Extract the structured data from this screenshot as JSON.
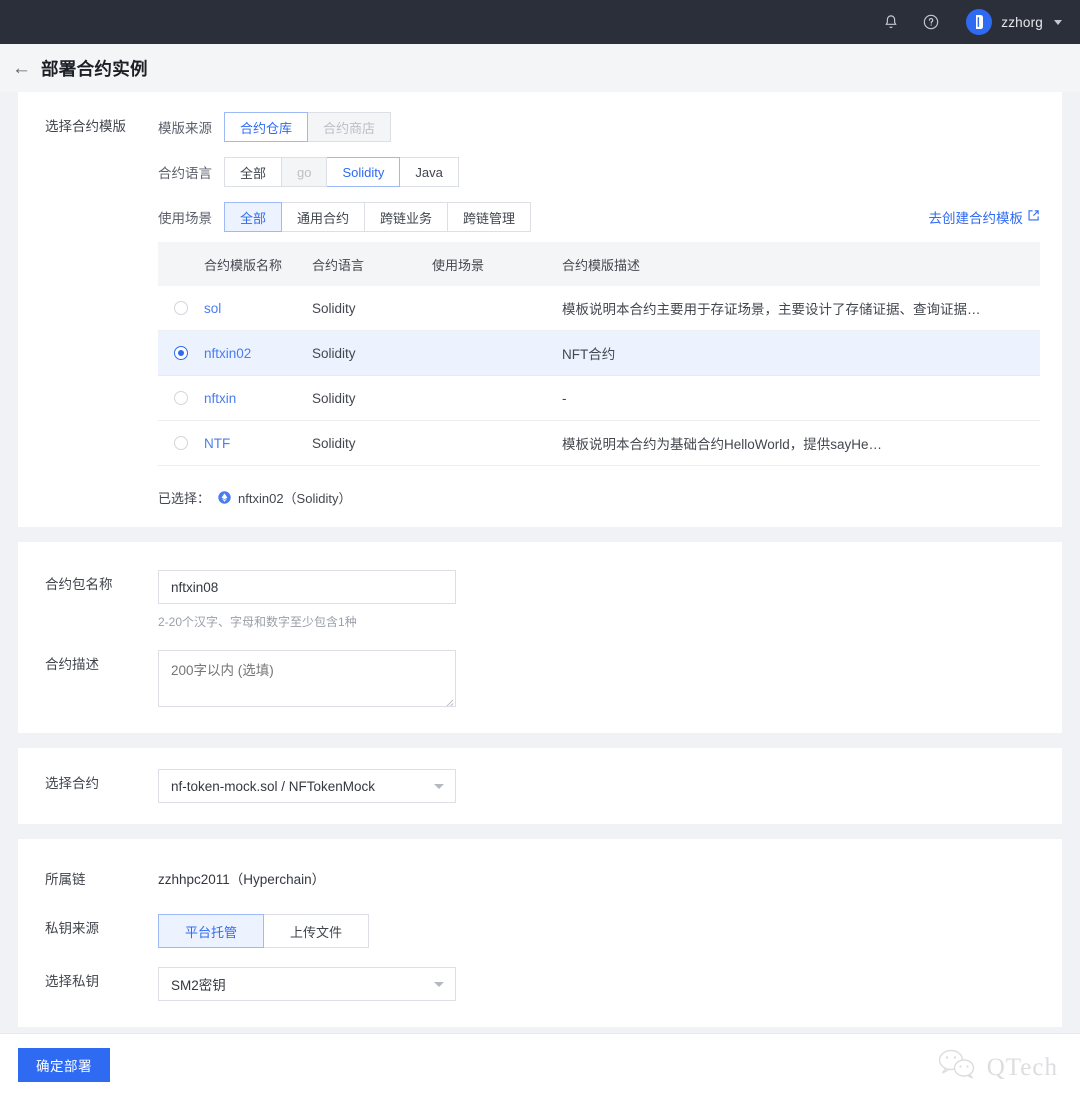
{
  "topbar": {
    "icons": [
      {
        "name": "bell-icon",
        "label": "通知"
      },
      {
        "name": "help-icon",
        "label": "帮助"
      }
    ],
    "user_name": "zzhorg"
  },
  "page": {
    "back_label": "←",
    "title": "部署合约实例"
  },
  "template_section": {
    "label": "选择合约模版",
    "filters": [
      {
        "caption": "模版来源",
        "options": [
          {
            "label": "合约仓库",
            "state": "active"
          },
          {
            "label": "合约商店",
            "state": "disabled"
          }
        ]
      },
      {
        "caption": "合约语言",
        "options": [
          {
            "label": "全部",
            "state": "normal"
          },
          {
            "label": "go",
            "state": "disabled"
          },
          {
            "label": "Solidity",
            "state": "active"
          },
          {
            "label": "Java",
            "state": "normal"
          }
        ]
      },
      {
        "caption": "使用场景",
        "options": [
          {
            "label": "全部",
            "state": "active-filled"
          },
          {
            "label": "通用合约",
            "state": "normal"
          },
          {
            "label": "跨链业务",
            "state": "normal"
          },
          {
            "label": "跨链管理",
            "state": "normal"
          }
        ]
      }
    ],
    "create_link": "去创建合约模板",
    "table": {
      "headers": [
        "合约模版名称",
        "合约语言",
        "使用场景",
        "合约模版描述"
      ],
      "rows": [
        {
          "selected": false,
          "name": "sol",
          "lang": "Solidity",
          "scene": "",
          "desc": "模板说明本合约主要用于存证场景，主要设计了存储证据、查询证据…"
        },
        {
          "selected": true,
          "name": "nftxin02",
          "lang": "Solidity",
          "scene": "",
          "desc": "NFT合约"
        },
        {
          "selected": false,
          "name": "nftxin",
          "lang": "Solidity",
          "scene": "",
          "desc": "-"
        },
        {
          "selected": false,
          "name": "NTF",
          "lang": "Solidity",
          "scene": "",
          "desc": "模板说明本合约为基础合约HelloWorld，提供sayHe…"
        }
      ]
    },
    "selected_prefix": "已选择：",
    "selected_value": "nftxin02（Solidity）"
  },
  "package_section": {
    "name_label": "合约包名称",
    "name_value": "nftxin08",
    "name_hint": "2-20个汉字、字母和数字至少包含1种",
    "desc_label": "合约描述",
    "desc_value": "",
    "desc_placeholder": "200字以内 (选填)"
  },
  "contract_section": {
    "label": "选择合约",
    "value": "nf-token-mock.sol / NFTokenMock"
  },
  "chain_section": {
    "chain_label": "所属链",
    "chain_value": "zzhhpc2011（Hyperchain）",
    "key_source_label": "私钥来源",
    "key_source_options": [
      {
        "label": "平台托管",
        "state": "active-filled"
      },
      {
        "label": "上传文件",
        "state": "normal"
      }
    ],
    "key_label": "选择私钥",
    "key_value": "SM2密钥"
  },
  "footer": {
    "deploy_label": "确定部署",
    "watermark_text": "QTech"
  },
  "colors": {
    "accent": "#2f6bf2",
    "topbar_bg": "#2b2f3a",
    "page_bg": "#f0f2f5",
    "row_selected_bg": "#edf3fe"
  }
}
